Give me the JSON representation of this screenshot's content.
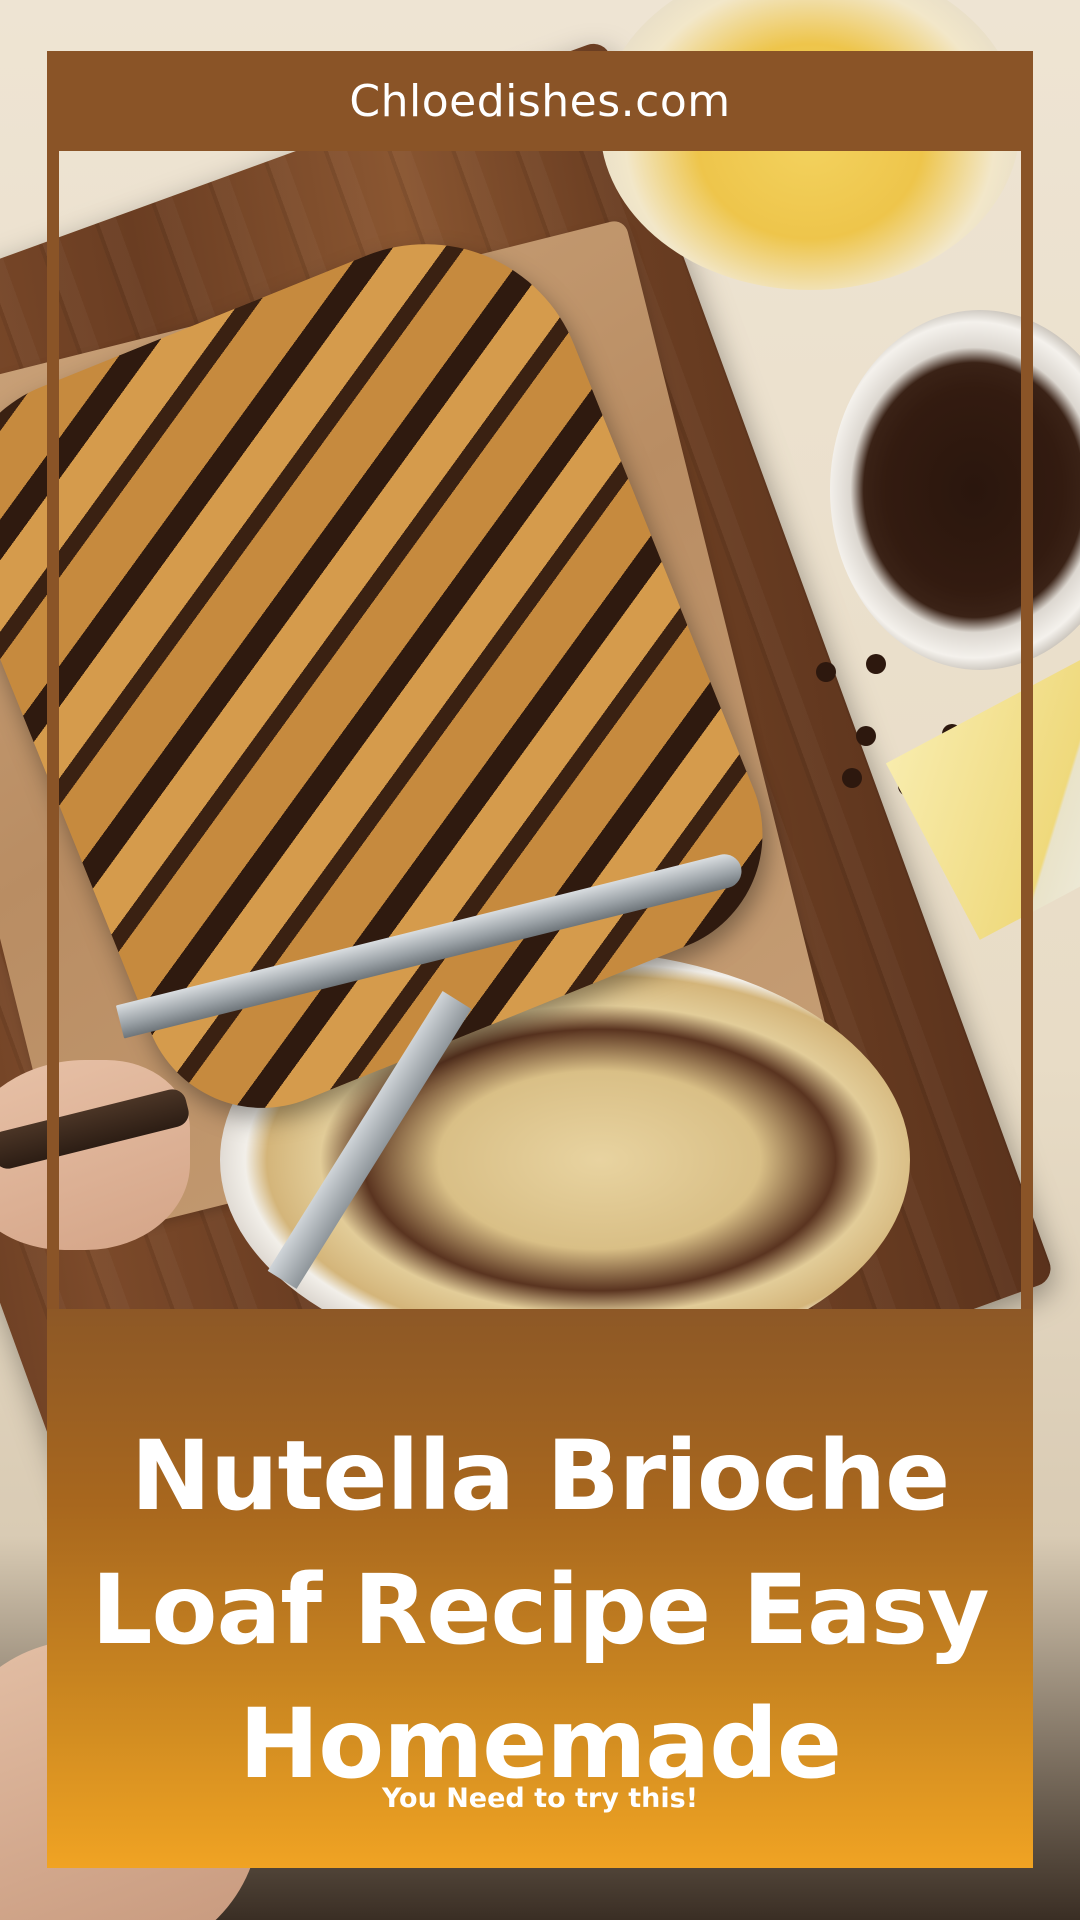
{
  "header": {
    "site_name": "Chloedishes.com"
  },
  "recipe": {
    "title": "Nutella Brioche Loaf Recipe Easy Homemade",
    "tagline": "You Need to try this!"
  },
  "colors": {
    "header_brown": "#8a5427",
    "footer_gradient_top": "#8d5826",
    "footer_gradient_bottom": "#f0a323",
    "text": "#ffffff"
  },
  "image": {
    "subject": "nutella-brioche-loaf-photo"
  }
}
